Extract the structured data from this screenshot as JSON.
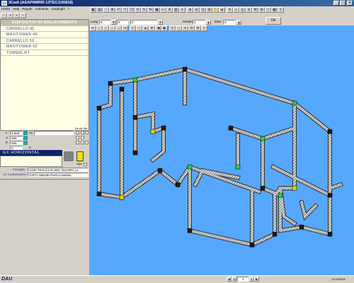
{
  "window": {
    "title": "3Cadi (ASAP/MIRRI 13TEC/100818)",
    "min_glyph": "_",
    "max_glyph": "□",
    "close_glyph": "×"
  },
  "menu": [
    "Ordini",
    "Help",
    "Regole",
    "Ambiente",
    "Cataloghi",
    "?"
  ],
  "toolbar": {
    "lung_label": "Lung",
    "lung_value": "0",
    "second_value": "0",
    "third_value": "0",
    "pendio_label": "Pendio",
    "pendio_value": "0",
    "misura_label": "Miss",
    "misura_value": "0",
    "ok_label": "Ok"
  },
  "categories": {
    "header": "DISPOSITIVI DI SOLLEVAMENTO",
    "items": [
      "CARRELLO 45",
      "MAXITOWER 40",
      "CARRELLO 52",
      "MAXITOWER 52",
      "TOWERLIFT"
    ]
  },
  "params": {
    "rows": [
      {
        "key": "L",
        "value": "3.000",
        "unit": "Ac"
      },
      {
        "key": "A",
        "value": "290",
        "unit": ""
      },
      {
        "key": "P",
        "value": "290",
        "unit": ""
      },
      {
        "key": "",
        "value": "0",
        "unit": "0"
      }
    ],
    "col_headers": "Se Alt Ste",
    "selected_item": "GX HORIZONTAL",
    "apx_label": "Apx"
  },
  "info": {
    "famiglia_label": "Famiglia",
    "famiglia_value": "GX30 TRALICCIO SEZ. QUADRA LA",
    "connessione_label": "Gi Connessione",
    "connessione_value": "GXFC+Spigotti+Pass+Coppiglie"
  },
  "status": {
    "logo": "DAU",
    "page": "1",
    "date": "11/10/2008"
  },
  "colors": {
    "canvas": "#56a8ff",
    "truss": "#c8c8c8",
    "truss_dark": "#1a1a1a",
    "connector_green": "#2ecc40",
    "connector_yellow": "#e8d000"
  }
}
